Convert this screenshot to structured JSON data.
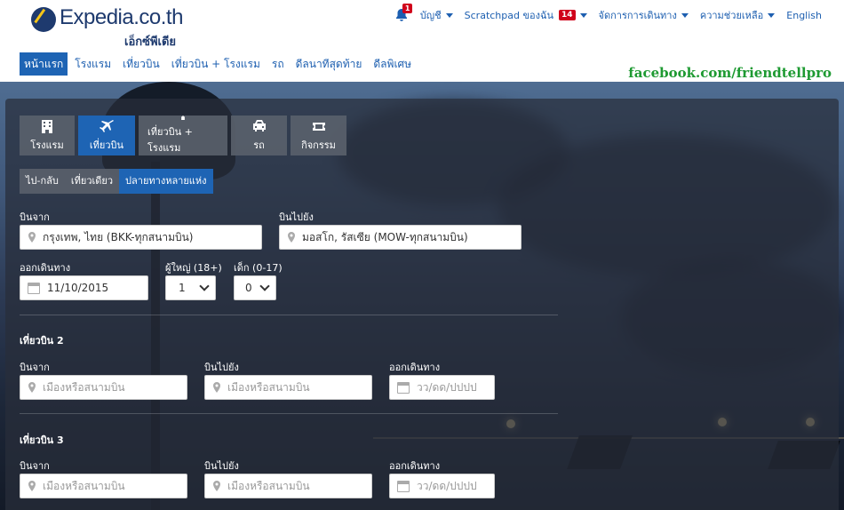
{
  "brand": {
    "logo_text": "Expedia.co.th",
    "logo_sub": "เอ็กซ์พีเดีย"
  },
  "topnav": {
    "bell_count": "1",
    "account": "บัญชี",
    "scratchpad": "Scratchpad ของฉัน",
    "scratchpad_count": "14",
    "manage_trips": "จัดการการเดินทาง",
    "help": "ความช่วยเหลือ",
    "language": "English"
  },
  "mainnav": {
    "tabs": [
      "หน้าแรก",
      "โรงแรม",
      "เที่ยวบิน",
      "เที่ยวบิน + โรงแรม",
      "รถ",
      "ดีลนาทีสุดท้าย",
      "ดีลพิเศษ"
    ]
  },
  "watermark": "facebook.com/friendtellpro",
  "search": {
    "product_tabs": [
      "โรงแรม",
      "เที่ยวบิน",
      "เที่ยวบิน + โรงแรม",
      "รถ",
      "กิจกรรม"
    ],
    "trip_types": [
      "ไป-กลับ",
      "เที่ยวเดียว",
      "ปลายทางหลายแห่ง"
    ],
    "flight1": {
      "from_label": "บินจาก",
      "from_value": "กรุงเทพ, ไทย (BKK-ทุกสนามบิน)",
      "to_label": "บินไปยัง",
      "to_value": "มอสโก, รัสเซีย (MOW-ทุกสนามบิน)",
      "depart_label": "ออกเดินทาง",
      "depart_value": "11/10/2015",
      "adults_label": "ผู้ใหญ่ (18+)",
      "adults_value": "1",
      "children_label": "เด็ก (0-17)",
      "children_value": "0"
    },
    "flight2": {
      "heading": "เที่ยวบิน 2",
      "from_label": "บินจาก",
      "from_placeholder": "เมืองหรือสนามบิน",
      "to_label": "บินไปยัง",
      "to_placeholder": "เมืองหรือสนามบิน",
      "depart_label": "ออกเดินทาง",
      "depart_placeholder": "วว/ดด/ปปปป"
    },
    "flight3": {
      "heading": "เที่ยวบิน 3",
      "from_label": "บินจาก",
      "from_placeholder": "เมืองหรือสนามบิน",
      "to_label": "บินไปยัง",
      "to_placeholder": "เมืองหรือสนามบิน",
      "depart_label": "ออกเดินทาง",
      "depart_placeholder": "วว/ดด/ปปปป"
    }
  }
}
